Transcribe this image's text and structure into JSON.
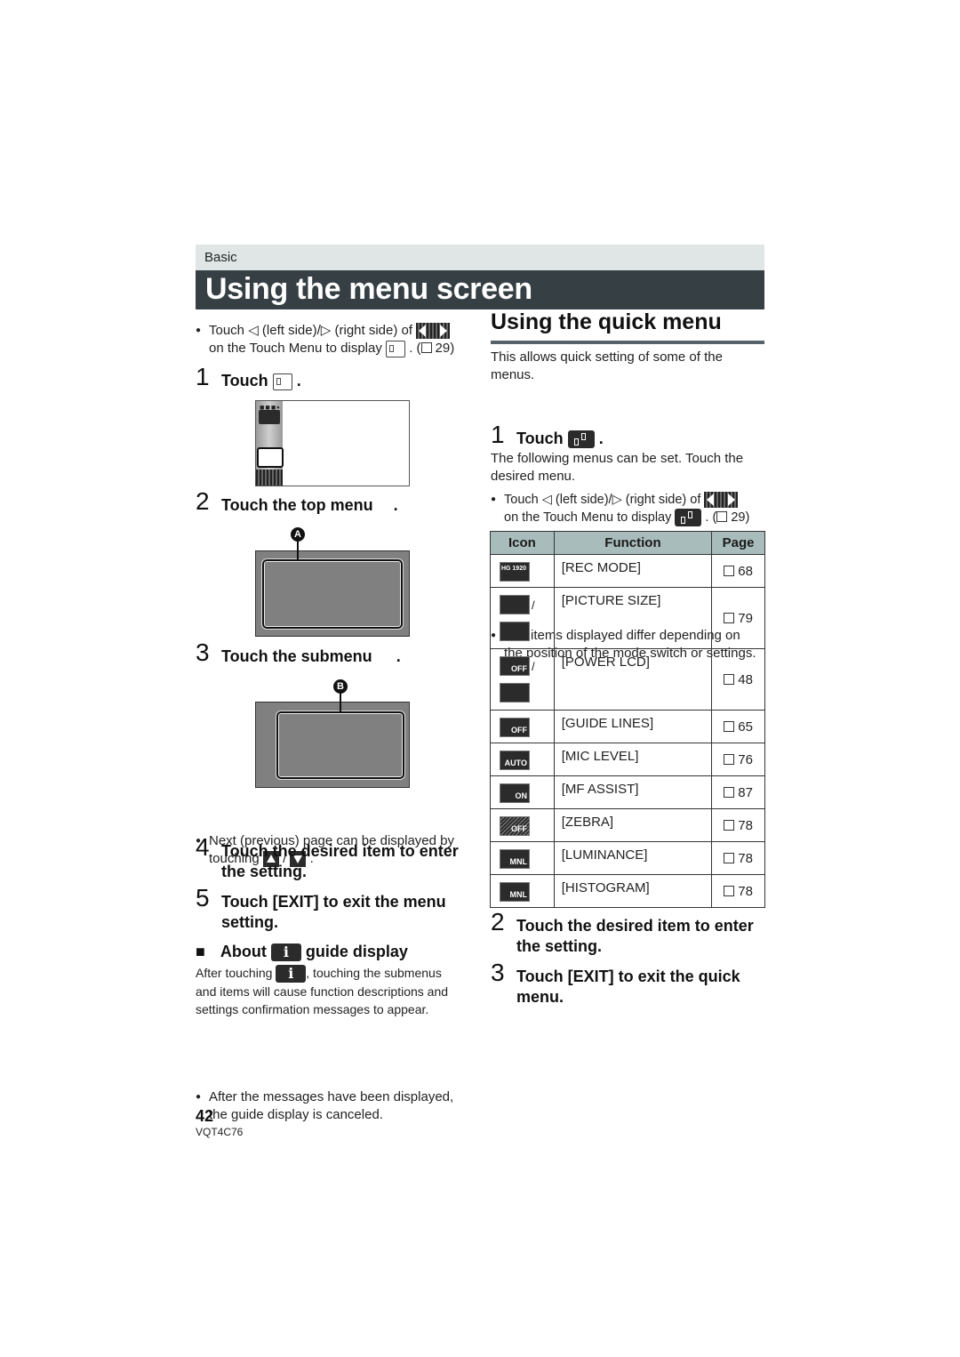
{
  "header": {
    "section": "Basic",
    "title": "Using the menu screen"
  },
  "left": {
    "intro_bullet": {
      "part1": "Touch ",
      "left_glyph": "◁",
      "part2": " (left side)/",
      "right_glyph": "▷",
      "part3": " (right side) of ",
      "line2a": "on the Touch Menu to display ",
      "line2b": ". (",
      "ref_page": "29)"
    },
    "step1": {
      "num": "1",
      "text": "Touch",
      "period": "."
    },
    "step2": {
      "num": "2",
      "text": "Touch the top menu",
      "period": ".",
      "callout": "A"
    },
    "step3": {
      "num": "3",
      "text": "Touch the submenu",
      "period": ".",
      "callout": "B"
    },
    "page_bullet": {
      "line1": "Next (previous) page can be displayed by",
      "line2a": "touching ",
      "sep": "/",
      "line2b": "."
    },
    "step4": {
      "num": "4",
      "line1": "Touch the desired item to enter",
      "line2": "the setting."
    },
    "step5": {
      "num": "5",
      "line1": "Touch [EXIT] to exit the menu",
      "line2": "setting."
    },
    "guide": {
      "square": "■",
      "heading_a": "About",
      "heading_b": "guide display",
      "info_glyph": "i",
      "para_a": "After touching ",
      "para_b": ", touching the submenus",
      "para_line2": "and items will cause function descriptions and",
      "para_line3": "settings confirmation messages to appear.",
      "bullet_line1": "After the messages have been displayed,",
      "bullet_line2": "the guide display is canceled."
    },
    "screen1": {
      "dots": "■■■▪"
    }
  },
  "right": {
    "heading": "Using the quick menu",
    "intro_line1": "This allows quick setting of some of the",
    "intro_line2": "menus.",
    "bullet": {
      "part1": "Touch ",
      "left_glyph": "◁",
      "part2": " (left side)/",
      "right_glyph": "▷",
      "part3": " (right side) of ",
      "line2a": "on the Touch Menu to display ",
      "line2b": ". (",
      "ref_page": "29)"
    },
    "step1": {
      "num": "1",
      "text": "Touch",
      "period": "."
    },
    "desc_line1": "The following menus can be set. Touch the",
    "desc_line2": "desired menu.",
    "note_line1": "The items displayed differ depending on",
    "note_line2": "the position of the mode switch or settings.",
    "table": {
      "headers": [
        "Icon",
        "Function",
        "Page"
      ],
      "rows": [
        {
          "icons": [
            "HG 1920"
          ],
          "function": "[REC MODE]",
          "page": "68"
        },
        {
          "icons": [
            "picture-size-wide",
            "picture-size-standard"
          ],
          "function": "[PICTURE SIZE]",
          "page": "79"
        },
        {
          "icons": [
            "OFF",
            "lcd-bright"
          ],
          "function": "[POWER LCD]",
          "page": "48"
        },
        {
          "icons": [
            "OFF"
          ],
          "function": "[GUIDE LINES]",
          "page": "65"
        },
        {
          "icons": [
            "AUTO"
          ],
          "function": "[MIC LEVEL]",
          "page": "76"
        },
        {
          "icons": [
            "ON"
          ],
          "function": "[MF ASSIST]",
          "page": "87"
        },
        {
          "icons": [
            "OFF"
          ],
          "function": "[ZEBRA]",
          "page": "78"
        },
        {
          "icons": [
            "MNL"
          ],
          "function": "[LUMINANCE]",
          "page": "78"
        },
        {
          "icons": [
            "MNL"
          ],
          "function": "[HISTOGRAM]",
          "page": "78"
        }
      ],
      "slash": "/"
    },
    "step2": {
      "num": "2",
      "line1": "Touch the desired item to enter",
      "line2": "the setting."
    },
    "step3": {
      "num": "3",
      "line1": "Touch [EXIT] to exit the quick",
      "line2": "menu."
    }
  },
  "footer": {
    "page_number": "42",
    "model_code": "VQT4C76"
  },
  "colors": {
    "title_band": "#353f44",
    "section_band": "#dfe6e5",
    "table_header": "#a9bcbc"
  }
}
